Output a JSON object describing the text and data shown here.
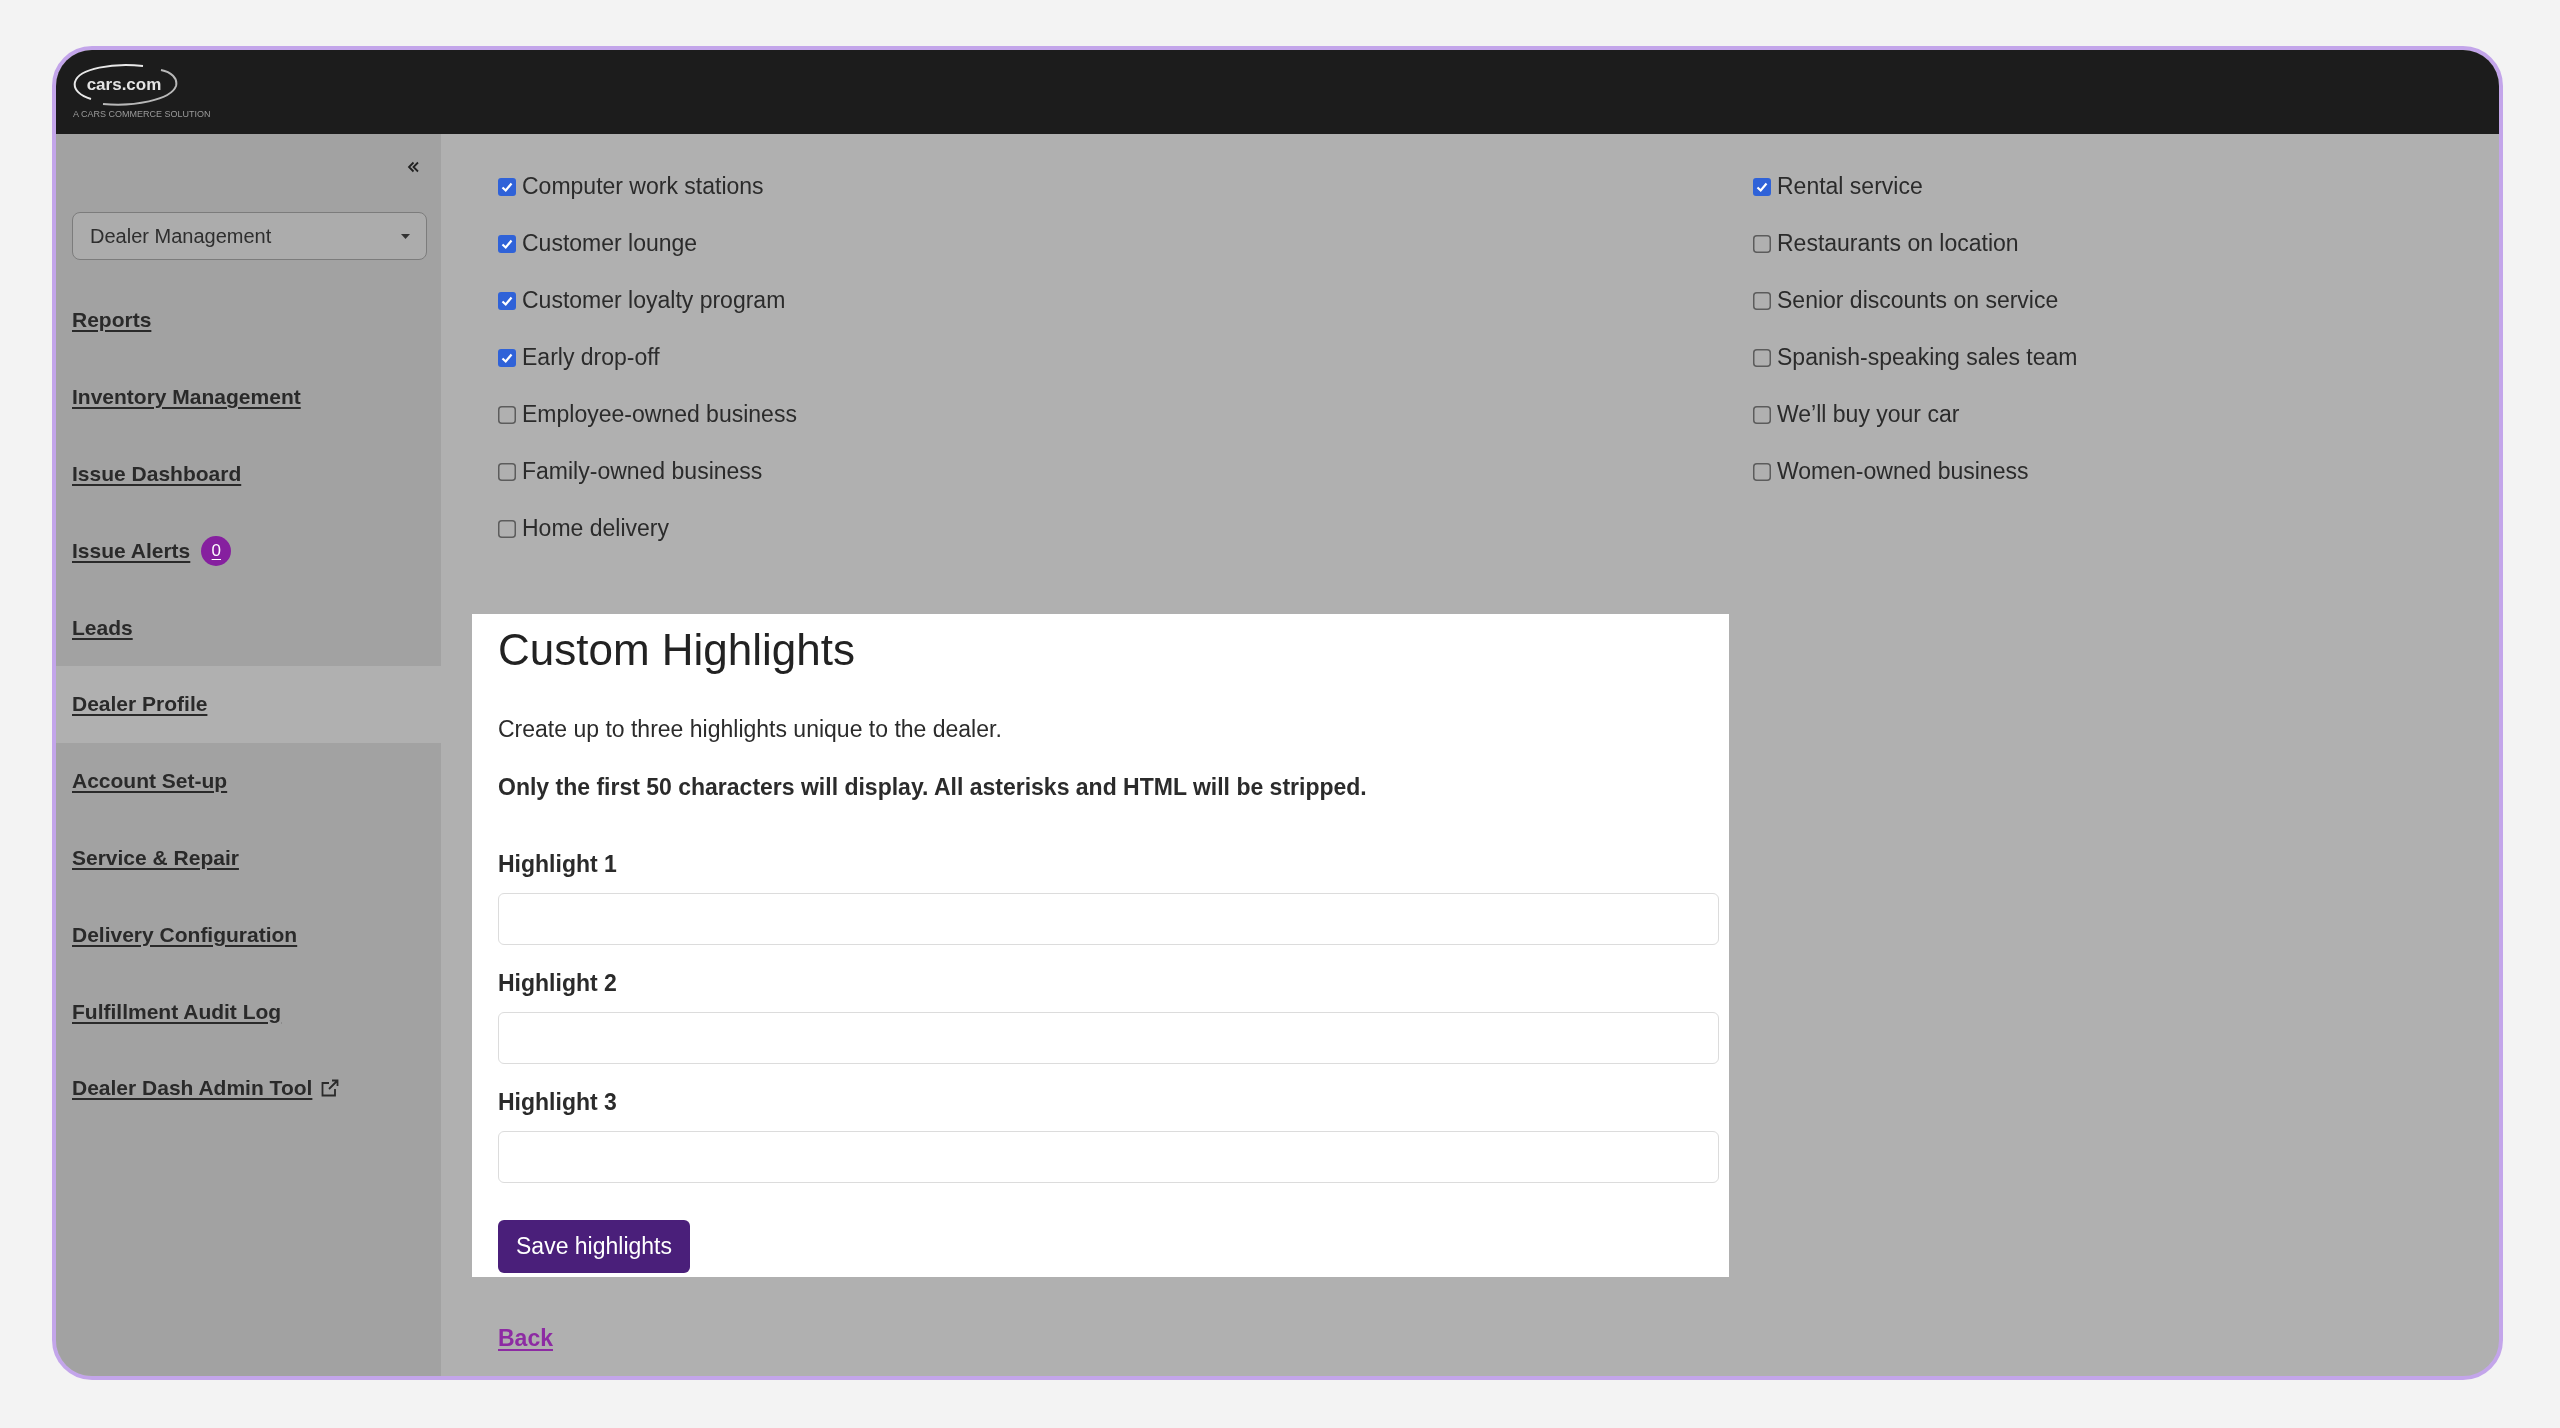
{
  "header": {
    "logo": {
      "wordmark": "cars.com",
      "tagline": "A CARS COMMERCE SOLUTION"
    }
  },
  "sidebar": {
    "dropdown": {
      "value": "Dealer Management"
    },
    "items": [
      {
        "label": "Reports",
        "selected": false,
        "external": false
      },
      {
        "label": "Inventory Management",
        "selected": false,
        "external": false
      },
      {
        "label": "Issue Dashboard",
        "selected": false,
        "external": false
      },
      {
        "label": "Issue Alerts",
        "selected": false,
        "external": false,
        "badge": "0"
      },
      {
        "label": "Leads",
        "selected": false,
        "external": false
      },
      {
        "label": "Dealer Profile",
        "selected": true,
        "external": false
      },
      {
        "label": "Account Set-up",
        "selected": false,
        "external": false
      },
      {
        "label": "Service & Repair",
        "selected": false,
        "external": false
      },
      {
        "label": "Delivery Configuration",
        "selected": false,
        "external": false
      },
      {
        "label": "Fulfillment Audit Log",
        "selected": false,
        "external": false
      },
      {
        "label": "Dealer Dash Admin Tool",
        "selected": false,
        "external": true
      }
    ]
  },
  "amenities": {
    "columns": [
      {
        "items": [
          {
            "label": "Computer work stations",
            "checked": true
          },
          {
            "label": "Customer lounge",
            "checked": true
          },
          {
            "label": "Customer loyalty program",
            "checked": true
          },
          {
            "label": "Early drop-off",
            "checked": true
          },
          {
            "label": "Employee-owned business",
            "checked": false
          },
          {
            "label": "Family-owned business",
            "checked": false
          },
          {
            "label": "Home delivery",
            "checked": false
          }
        ]
      },
      {
        "items": [
          {
            "label": "Rental service",
            "checked": true
          },
          {
            "label": "Restaurants on location",
            "checked": false
          },
          {
            "label": "Senior discounts on service",
            "checked": false
          },
          {
            "label": "Spanish-speaking sales team",
            "checked": false
          },
          {
            "label": "We’ll buy your car",
            "checked": false
          },
          {
            "label": "Women-owned business",
            "checked": false
          }
        ]
      }
    ]
  },
  "custom_highlights": {
    "title": "Custom Highlights",
    "description": "Create up to three highlights unique to the dealer.",
    "notice": "Only the first 50 characters will display. All asterisks and HTML will be stripped.",
    "fields": [
      {
        "label": "Highlight 1"
      },
      {
        "label": "Highlight 2"
      },
      {
        "label": "Highlight 3"
      }
    ],
    "save_button": "Save highlights"
  },
  "back_link": "Back"
}
